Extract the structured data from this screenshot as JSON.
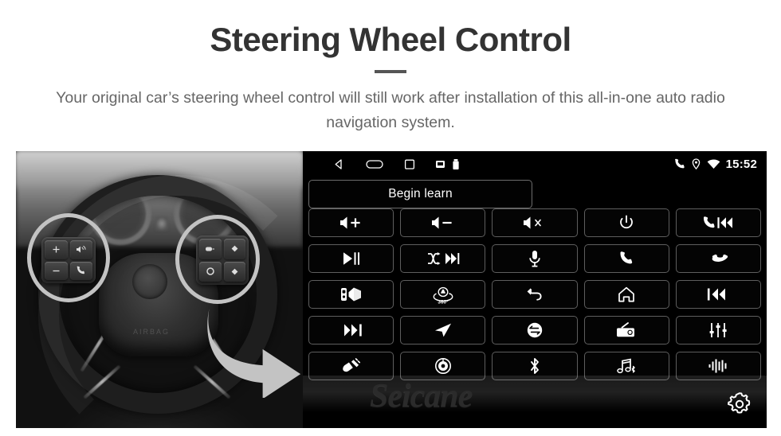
{
  "header": {
    "title": "Steering Wheel Control",
    "subtitle": "Your original car’s steering wheel control will still work after installation of this all-in-one auto radio navigation system."
  },
  "colors": {
    "accent_yellow": "#F5C518",
    "title_gray": "#333333",
    "subtitle_gray": "#666666",
    "panel_black": "#000000",
    "button_border": "#5e5e5e"
  },
  "photo": {
    "alt": "grayscale steering wheel with highlighted control pods",
    "airbag_text": "AIRBAG",
    "highlights": [
      {
        "name": "left-control-pod-highlight"
      },
      {
        "name": "right-control-pod-highlight"
      }
    ],
    "arrow": {
      "name": "yellow-pointer-arrow"
    },
    "left_pod_keys": [
      {
        "name": "volume-up-key",
        "glyph": "+"
      },
      {
        "name": "voice-key",
        "glyph": "voice"
      },
      {
        "name": "volume-down-key",
        "glyph": "−"
      },
      {
        "name": "call-key",
        "glyph": "phone"
      }
    ],
    "right_pod_keys": [
      {
        "name": "mode-key",
        "glyph": "mode"
      },
      {
        "name": "up-key",
        "glyph": "◆"
      },
      {
        "name": "ok-key",
        "glyph": "○"
      },
      {
        "name": "down-key",
        "glyph": "◆"
      }
    ]
  },
  "panel": {
    "statusbar": {
      "nav_icons": [
        {
          "name": "back-icon"
        },
        {
          "name": "home-icon"
        },
        {
          "name": "recents-icon"
        },
        {
          "name": "sd-card-icon"
        },
        {
          "name": "usb-storage-icon"
        }
      ],
      "status_icons": [
        {
          "name": "phone-icon"
        },
        {
          "name": "location-pin-icon"
        },
        {
          "name": "wifi-icon"
        }
      ],
      "time": "15:52"
    },
    "learn_button": {
      "label": "Begin learn"
    },
    "watermark": "Seicane",
    "settings_button": {
      "name": "settings-gear-button"
    },
    "keys": [
      {
        "name": "volume-up-button",
        "icon": "volume-up-icon"
      },
      {
        "name": "volume-down-button",
        "icon": "volume-down-icon"
      },
      {
        "name": "mute-button",
        "icon": "volume-mute-icon"
      },
      {
        "name": "power-button",
        "icon": "power-icon"
      },
      {
        "name": "call-previous-button",
        "icon": "phone-previous-icon"
      },
      {
        "name": "play-pause-button",
        "icon": "play-pause-icon"
      },
      {
        "name": "shuffle-next-button",
        "icon": "shuffle-next-icon"
      },
      {
        "name": "voice-mic-button",
        "icon": "microphone-icon"
      },
      {
        "name": "answer-call-button",
        "icon": "phone-answer-icon"
      },
      {
        "name": "hang-up-button",
        "icon": "phone-hangup-icon"
      },
      {
        "name": "car-speaker-button",
        "icon": "car-speaker-icon"
      },
      {
        "name": "camera-360-button",
        "icon": "camera-360-icon",
        "label": "360°"
      },
      {
        "name": "back-button",
        "icon": "back-arrow-icon"
      },
      {
        "name": "home-button",
        "icon": "home-house-icon"
      },
      {
        "name": "previous-track-button",
        "icon": "previous-track-icon"
      },
      {
        "name": "next-track-button",
        "icon": "next-track-icon"
      },
      {
        "name": "navigation-button",
        "icon": "navigation-arrow-icon"
      },
      {
        "name": "source-mode-button",
        "icon": "source-switch-icon"
      },
      {
        "name": "radio-button",
        "icon": "radio-icon"
      },
      {
        "name": "equalizer-button",
        "icon": "equalizer-icon"
      },
      {
        "name": "usb-button",
        "icon": "usb-plug-icon"
      },
      {
        "name": "disc-button",
        "icon": "cd-disc-icon"
      },
      {
        "name": "bluetooth-button",
        "icon": "bluetooth-icon"
      },
      {
        "name": "bluetooth-music-button",
        "icon": "bluetooth-music-icon"
      },
      {
        "name": "voice-wave-button",
        "icon": "audio-waveform-icon"
      }
    ]
  }
}
